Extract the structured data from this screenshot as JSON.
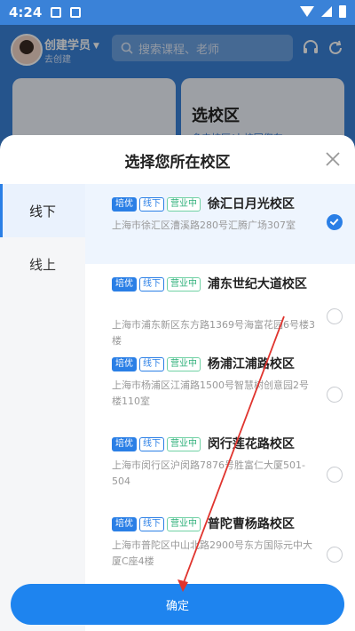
{
  "status_bar": {
    "time": "4:24"
  },
  "header": {
    "user_name": "创建学员",
    "user_sub": "去创建",
    "search_placeholder": "搜索课程、老师"
  },
  "background_card": {
    "title": "选校区",
    "subtitle": "多去校区/上校园您车●"
  },
  "sheet": {
    "title": "选择您所在校区",
    "tabs": [
      {
        "label": "线下",
        "active": true
      },
      {
        "label": "线上",
        "active": false
      }
    ],
    "campuses": [
      {
        "tags": [
          "培优",
          "线下",
          "营业中"
        ],
        "name": "徐汇日月光校区",
        "address": "上海市徐汇区漕溪路280号汇腾广场307室",
        "selected": true
      },
      {
        "tags": [
          "培优",
          "线下",
          "营业中"
        ],
        "name": "浦东世纪大道校区",
        "address": "上海市浦东新区东方路1369号海富花园6号楼3楼",
        "selected": false
      },
      {
        "tags": [
          "培优",
          "线下",
          "营业中"
        ],
        "name": "杨浦江浦路校区",
        "address": "上海市杨浦区江浦路1500号智慧树创意园2号楼110室",
        "selected": false
      },
      {
        "tags": [
          "培优",
          "线下",
          "营业中"
        ],
        "name": "闵行莲花路校区",
        "address": "上海市闵行区沪闵路7876号胜富仁大厦501-504",
        "selected": false
      },
      {
        "tags": [
          "培优",
          "线下",
          "营业中"
        ],
        "name": "普陀曹杨路校区",
        "address": "上海市普陀区中山北路2900号东方国际元中大厦C座4楼",
        "selected": false
      }
    ],
    "confirm_label": "确定"
  },
  "colors": {
    "primary": "#1e84ef",
    "header_bg": "#3a82d8",
    "status_open": "#2fb07a",
    "annotation_arrow": "#e0342e"
  }
}
